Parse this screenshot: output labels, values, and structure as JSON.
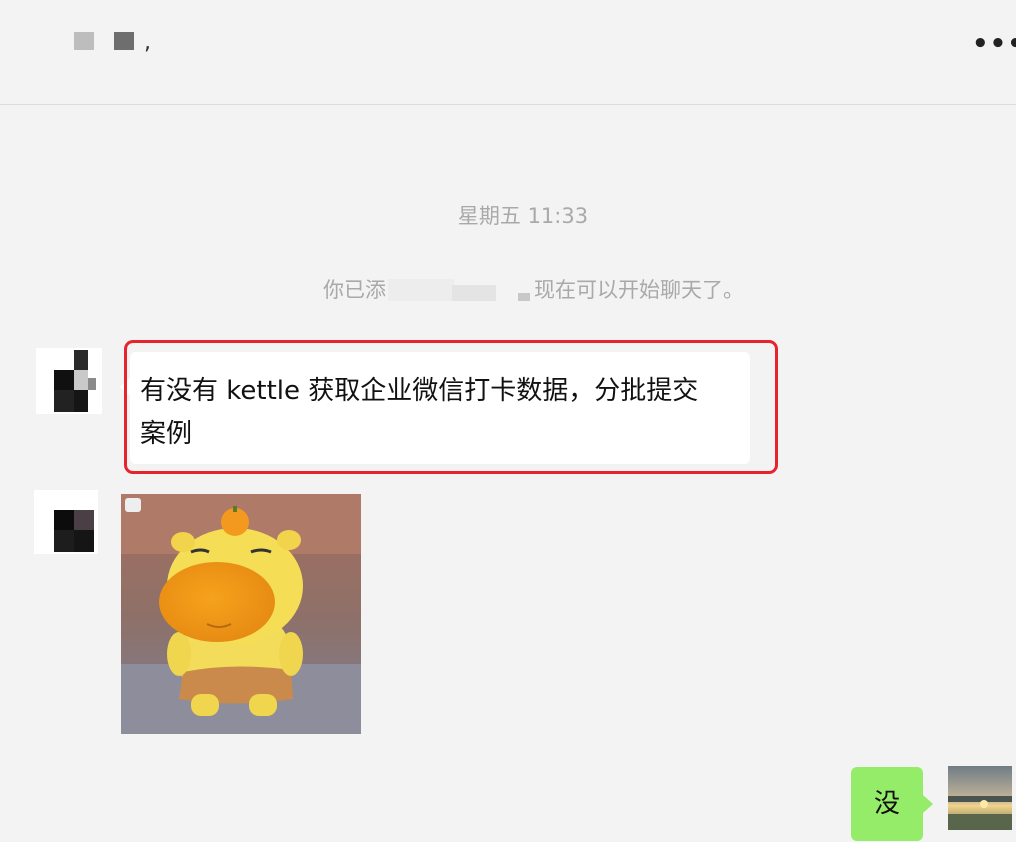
{
  "header": {
    "title_suffix": ",",
    "more_label": "•••"
  },
  "chat": {
    "timestamp": "星期五 11:33",
    "system_message": {
      "prefix": "你已添",
      "suffix": "现在可以开始聊天了。"
    },
    "messages": [
      {
        "direction": "incoming",
        "type": "text",
        "text_line1": "有没有 kettle 获取企业微信打卡数据，分批提交",
        "text_line2": "案例",
        "highlighted": true
      },
      {
        "direction": "incoming",
        "type": "sticker",
        "sticker_name": "yellow-cartoon-creature-sticker"
      },
      {
        "direction": "outgoing",
        "type": "text",
        "text": "没"
      }
    ]
  },
  "colors": {
    "background": "#f3f3f3",
    "incoming_bubble": "#ffffff",
    "outgoing_bubble": "#95ec69",
    "highlight_border": "#e5242b",
    "meta_text": "#a9a9a9"
  }
}
